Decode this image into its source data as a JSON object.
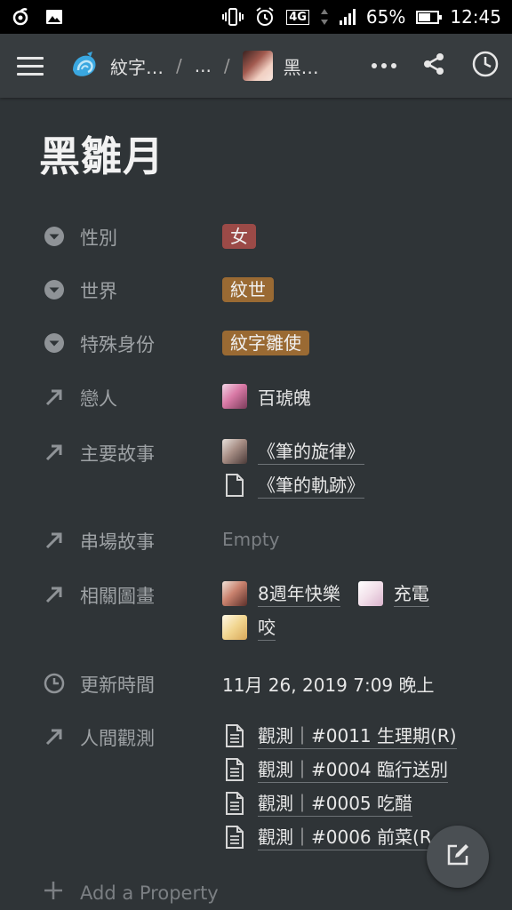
{
  "status_bar": {
    "network": "4G",
    "battery": "65%",
    "battery_level": 0.65,
    "time": "12:45"
  },
  "topbar": {
    "crumb_workspace": "紋字…",
    "crumb_ellipsis": "...",
    "crumb_page": "黑…",
    "icons": [
      "menu-icon",
      "seashell-logo-icon",
      "more-icon",
      "share-icon",
      "history-clock-icon"
    ]
  },
  "page": {
    "title": "黑雛月"
  },
  "properties": {
    "gender": {
      "label": "性別",
      "value": "女",
      "color": "#9b4a47"
    },
    "world": {
      "label": "世界",
      "value": "紋世",
      "color": "#9a6a33"
    },
    "identity": {
      "label": "特殊身份",
      "value": "紋字雛使",
      "color": "#9a6a33"
    },
    "lover": {
      "label": "戀人",
      "value": "百琥魄"
    },
    "main_story": {
      "label": "主要故事",
      "items": [
        "《筆的旋律》",
        "《筆的軌跡》"
      ]
    },
    "cameo_story": {
      "label": "串場故事",
      "empty": "Empty"
    },
    "related_art": {
      "label": "相關圖畫",
      "items": [
        "8週年快樂",
        "充電",
        "咬"
      ]
    },
    "updated": {
      "label": "更新時間",
      "value": "11月 26, 2019 7:09 晚上"
    },
    "observation": {
      "label": "人間觀測",
      "items": [
        "觀測｜#0011 生理期(R)",
        "觀測｜#0004 臨行送別",
        "觀測｜#0005 吃醋",
        "觀測｜#0006 前菜(R"
      ]
    }
  },
  "add_property": "Add a Property"
}
